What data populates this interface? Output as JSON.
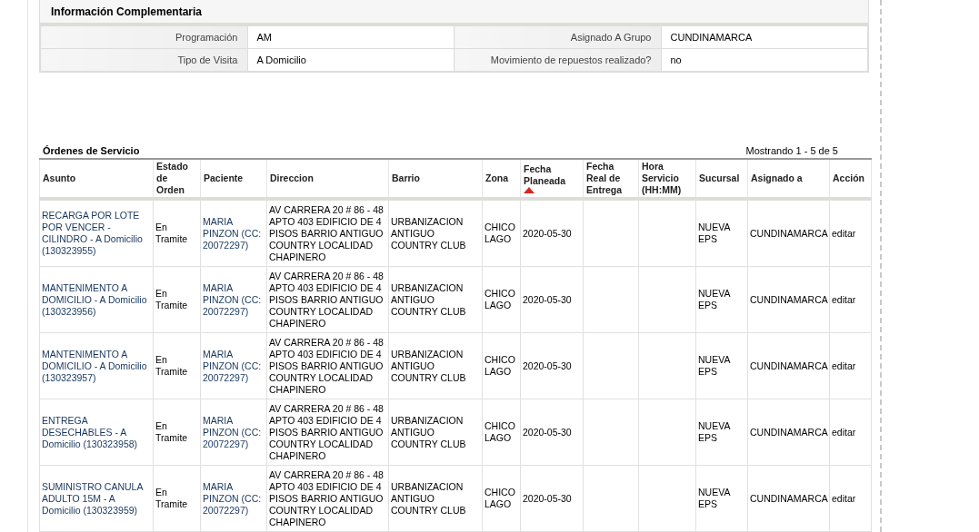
{
  "info_panel": {
    "title": "Información Complementaria",
    "rows": [
      [
        {
          "label": "Programación",
          "value": "AM"
        },
        {
          "label": "Asignado A Grupo",
          "value": "CUNDINAMARCA"
        }
      ],
      [
        {
          "label": "Tipo de Visita",
          "value": "A Domicilio"
        },
        {
          "label": "Movimiento de repuestos realizado?",
          "value": "no"
        }
      ]
    ]
  },
  "orders": {
    "title": "Órdenes de Servicio",
    "pagination": "Mostrando 1 - 5 de 5",
    "columns": [
      {
        "label": "Asunto",
        "sorted": false
      },
      {
        "label": "Estado de Orden",
        "sorted": false
      },
      {
        "label": "Paciente",
        "sorted": false
      },
      {
        "label": "Direccion",
        "sorted": false
      },
      {
        "label": "Barrio",
        "sorted": false
      },
      {
        "label": "Zona",
        "sorted": false
      },
      {
        "label": "Fecha Planeada",
        "sorted": true
      },
      {
        "label": "Fecha Real de Entrega",
        "sorted": false
      },
      {
        "label": "Hora Servicio (HH:MM)",
        "sorted": false
      },
      {
        "label": "Sucursal",
        "sorted": false
      },
      {
        "label": "Asignado a",
        "sorted": false
      },
      {
        "label": "Acción",
        "sorted": false
      }
    ],
    "rows": [
      {
        "asunto": "RECARGA POR LOTE POR VENCER - CILINDRO - A Domicilio (130323955)",
        "estado": "En Tramite",
        "paciente": "MARIA PINZON (CC: 20072297)",
        "direccion": "AV CARRERA 20 # 86 - 48 APTO 403 EDIFICIO DE 4 PISOS BARRIO ANTIGUO COUNTRY LOCALIDAD CHAPINERO",
        "barrio": "URBANIZACION ANTIGUO COUNTRY CLUB",
        "zona": "CHICO LAGO",
        "fecha_planeada": "2020-05-30",
        "sucursal": "NUEVA EPS",
        "asignado": "CUNDINAMARCA",
        "accion": "editar"
      },
      {
        "asunto": "MANTENIMENTO A DOMICILIO - A Domicilio (130323956)",
        "estado": "En Tramite",
        "paciente": "MARIA PINZON (CC: 20072297)",
        "direccion": "AV CARRERA 20 # 86 - 48 APTO 403 EDIFICIO DE 4 PISOS BARRIO ANTIGUO COUNTRY LOCALIDAD CHAPINERO",
        "barrio": "URBANIZACION ANTIGUO COUNTRY CLUB",
        "zona": "CHICO LAGO",
        "fecha_planeada": "2020-05-30",
        "sucursal": "NUEVA EPS",
        "asignado": "CUNDINAMARCA",
        "accion": "editar"
      },
      {
        "asunto": "MANTENIMENTO A DOMICILIO - A Domicilio (130323957)",
        "estado": "En Tramite",
        "paciente": "MARIA PINZON (CC: 20072297)",
        "direccion": "AV CARRERA 20 # 86 - 48 APTO 403 EDIFICIO DE 4 PISOS BARRIO ANTIGUO COUNTRY LOCALIDAD CHAPINERO",
        "barrio": "URBANIZACION ANTIGUO COUNTRY CLUB",
        "zona": "CHICO LAGO",
        "fecha_planeada": "2020-05-30",
        "sucursal": "NUEVA EPS",
        "asignado": "CUNDINAMARCA",
        "accion": "editar"
      },
      {
        "asunto": "ENTREGA DESECHABLES - A Domicilio (130323958)",
        "estado": "En Tramite",
        "paciente": "MARIA PINZON (CC: 20072297)",
        "direccion": "AV CARRERA 20 # 86 - 48 APTO 403 EDIFICIO DE 4 PISOS BARRIO ANTIGUO COUNTRY LOCALIDAD CHAPINERO",
        "barrio": "URBANIZACION ANTIGUO COUNTRY CLUB",
        "zona": "CHICO LAGO",
        "fecha_planeada": "2020-05-30",
        "sucursal": "NUEVA EPS",
        "asignado": "CUNDINAMARCA",
        "accion": "editar"
      },
      {
        "asunto": "SUMINISTRO CANULA ADULTO 15M - A Domicilio (130323959)",
        "estado": "En Tramite",
        "paciente": "MARIA PINZON (CC: 20072297)",
        "direccion": "AV CARRERA 20 # 86 - 48 APTO 403 EDIFICIO DE 4 PISOS BARRIO ANTIGUO COUNTRY LOCALIDAD CHAPINERO",
        "barrio": "URBANIZACION ANTIGUO COUNTRY CLUB",
        "zona": "CHICO LAGO",
        "fecha_planeada": "2020-05-30",
        "sucursal": "NUEVA EPS",
        "asignado": "CUNDINAMARCA",
        "accion": "editar"
      }
    ]
  }
}
